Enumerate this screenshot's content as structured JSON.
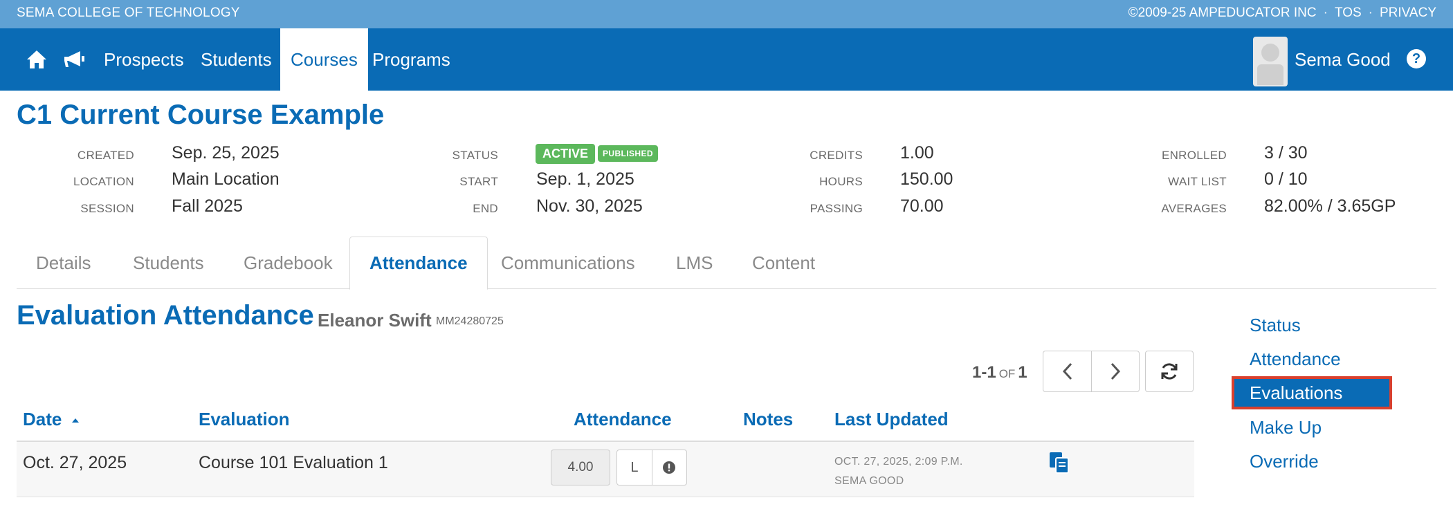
{
  "topbar": {
    "school": "SEMA COLLEGE OF TECHNOLOGY",
    "copyright": "©2009-25 AMPEDUCATOR INC",
    "sep1": "·",
    "tos": "TOS",
    "sep2": "·",
    "privacy": "PRIVACY"
  },
  "nav": {
    "items": [
      "Prospects",
      "Students",
      "Courses",
      "Programs"
    ],
    "active": "Courses",
    "username": "Sema Good",
    "help": "?"
  },
  "course": {
    "title": "C1 Current Course Example",
    "meta": {
      "created_label": "CREATED",
      "created": "Sep. 25, 2025",
      "location_label": "LOCATION",
      "location": "Main Location",
      "session_label": "SESSION",
      "session": "Fall 2025",
      "status_label": "STATUS",
      "status": "ACTIVE",
      "published": "PUBLISHED",
      "start_label": "START",
      "start": "Sep. 1, 2025",
      "end_label": "END",
      "end": "Nov. 30, 2025",
      "credits_label": "CREDITS",
      "credits": "1.00",
      "hours_label": "HOURS",
      "hours": "150.00",
      "passing_label": "PASSING",
      "passing": "70.00",
      "enrolled_label": "ENROLLED",
      "enrolled": "3 / 30",
      "waitlist_label": "WAIT LIST",
      "waitlist": "0 / 10",
      "averages_label": "AVERAGES",
      "averages": "82.00% / 3.65GP"
    }
  },
  "tabs": [
    "Details",
    "Students",
    "Gradebook",
    "Attendance",
    "Communications",
    "LMS",
    "Content"
  ],
  "active_tab": "Attendance",
  "section": {
    "title": "Evaluation Attendance",
    "student_name": "Eleanor Swift",
    "student_id": "MM24280725"
  },
  "pager": {
    "range": "1-1",
    "of": "OF",
    "total": "1"
  },
  "table": {
    "headers": [
      "Date",
      "Evaluation",
      "Attendance",
      "Notes",
      "Last Updated"
    ],
    "rows": [
      {
        "date": "Oct. 27, 2025",
        "evaluation": "Course 101 Evaluation 1",
        "attendance": "4.00",
        "late_btn": "L",
        "notes": "",
        "updated_date": "OCT. 27, 2025, 2:09 P.M.",
        "updated_by": "SEMA GOOD"
      }
    ]
  },
  "side_menu": {
    "items": [
      "Status",
      "Attendance",
      "Evaluations",
      "Make Up",
      "Override"
    ],
    "selected": "Evaluations"
  },
  "colors": {
    "brand": "#0a6bb5",
    "topstrip": "#5fa1d4",
    "status_green": "#5cb85c",
    "highlight_border": "#d9402e"
  }
}
